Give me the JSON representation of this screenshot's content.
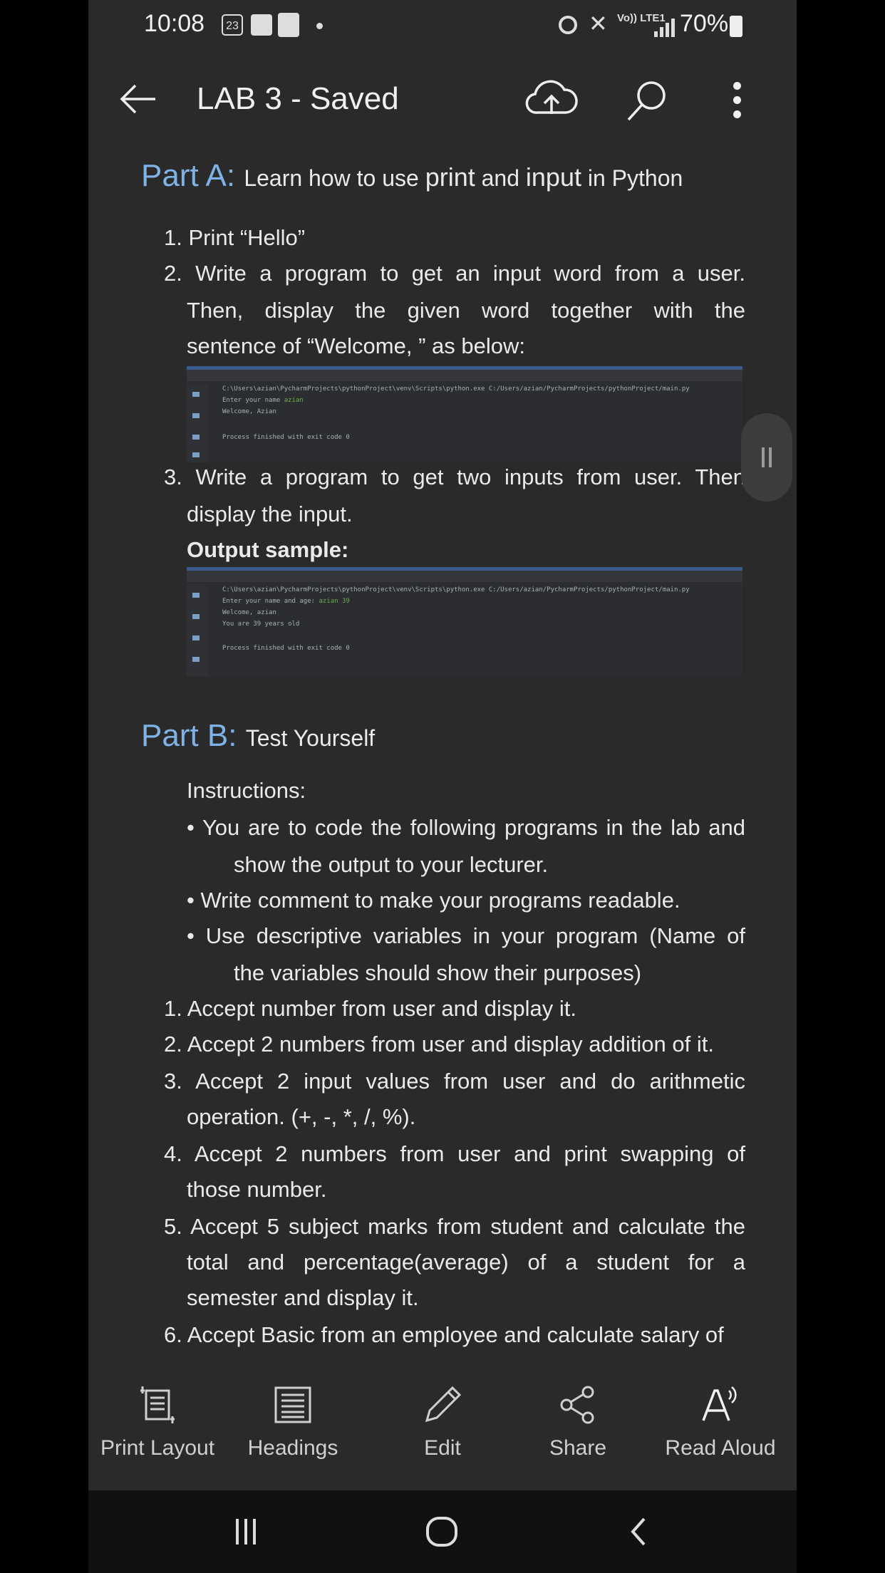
{
  "status": {
    "time": "10:08",
    "badge": "23",
    "network": "Vo)) LTE1",
    "battery": "70%"
  },
  "appbar": {
    "title": "LAB 3 - Saved",
    "icons": [
      "back-arrow-icon",
      "cloud-upload-icon",
      "search-icon",
      "more-icon"
    ]
  },
  "partA": {
    "heading": "Part A:",
    "subtitle_pre": "Learn how to use ",
    "subtitle_print": "print",
    "subtitle_mid": " and ",
    "subtitle_input": "input",
    "subtitle_post": " in Python",
    "items": [
      "1. Print “Hello”",
      "2. Write a program to get an input word from a user.",
      "Then, display the given word together with the",
      "sentence of “Welcome, ” as below:",
      "3. Write a program to get two inputs from user. Then",
      "display the input."
    ],
    "output_label": "Output sample:",
    "shot1": [
      "C:\\Users\\azian\\PycharmProjects\\pythonProject\\venv\\Scripts\\python.exe C:/Users/azian/PycharmProjects/pythonProject/main.py",
      "Enter your name ",
      "azian",
      "Welcome,   Azian",
      "Process finished with exit code 0"
    ],
    "shot2": [
      "C:\\Users\\azian\\PycharmProjects\\pythonProject\\venv\\Scripts\\python.exe C:/Users/azian/PycharmProjects/pythonProject/main.py",
      "Enter your name and age: ",
      "azian 39",
      "Welcome,  azian",
      "You are 39 years old",
      "Process finished with exit code 0"
    ]
  },
  "partB": {
    "heading": "Part B:",
    "subtitle": "Test Yourself",
    "instructions_label": "Instructions:",
    "bullets": [
      "• You are to code the following programs in the lab and",
      "show the output to your lecturer.",
      "• Write comment to make your programs readable.",
      "• Use descriptive variables in your program (Name of",
      "the variables should show their purposes)"
    ],
    "items": [
      "1. Accept number from user and display it.",
      "2. Accept 2 numbers from user and display addition of it.",
      "3. Accept 2 input values from user and do arithmetic",
      "operation. (+, -, *, /, %).",
      "4. Accept 2 numbers from user and print swapping of",
      "those number.",
      "5. Accept 5 subject marks from student and calculate the",
      "total and percentage(average) of a student for a",
      "semester and display it.",
      "6. Accept Basic from an employee and calculate salary of"
    ]
  },
  "bottombar": {
    "items": [
      {
        "label": "Print Layout",
        "icon": "print-layout-icon"
      },
      {
        "label": "Headings",
        "icon": "headings-icon"
      },
      {
        "label": "Edit",
        "icon": "pencil-icon"
      },
      {
        "label": "Share",
        "icon": "share-icon"
      },
      {
        "label": "Read Aloud",
        "icon": "read-aloud-icon"
      }
    ]
  },
  "colors": {
    "heading": "#7fb2e6",
    "background": "#2a2a2a",
    "text": "#eaeaea"
  }
}
